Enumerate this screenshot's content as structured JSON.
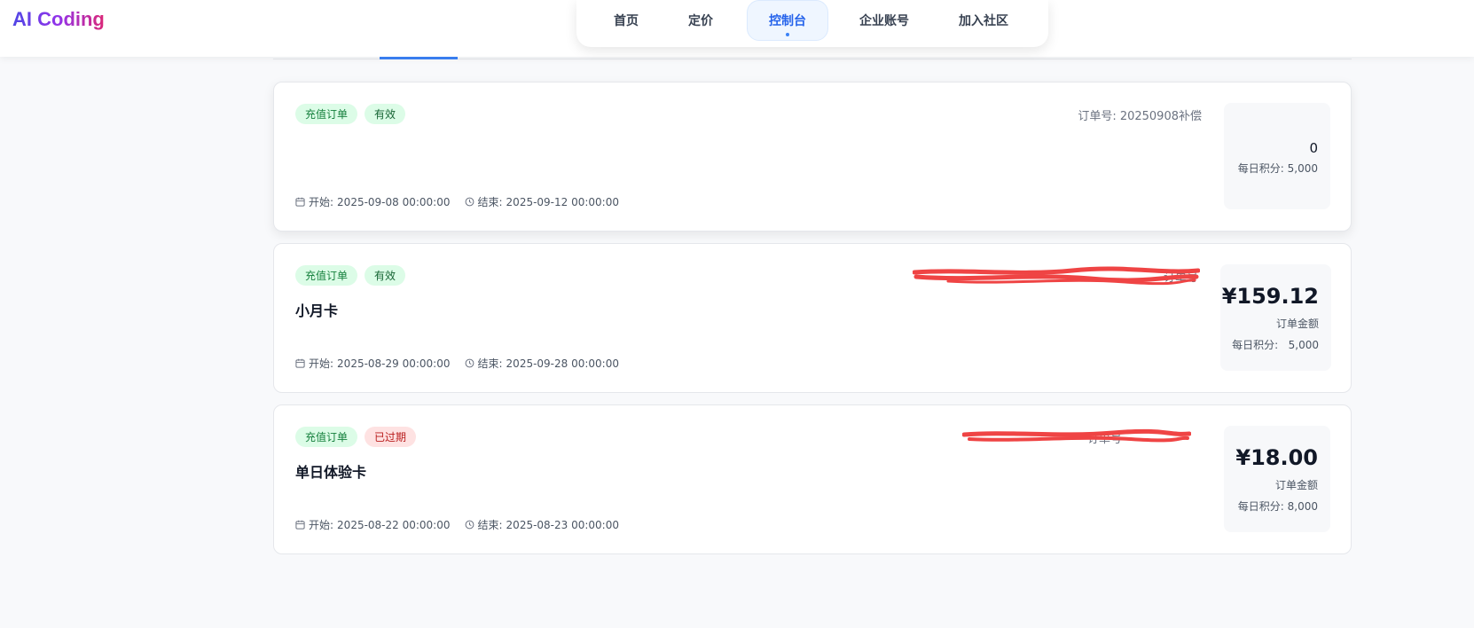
{
  "app": {
    "logo": "AI Coding"
  },
  "nav": {
    "items": [
      {
        "label": "首页"
      },
      {
        "label": "定价"
      },
      {
        "label": "控制台"
      },
      {
        "label": "企业账号"
      },
      {
        "label": "加入社区"
      }
    ],
    "active": "控制台"
  },
  "orders": [
    {
      "type_tag": "充值订单",
      "status_tag": "有效",
      "name": "",
      "order_no_label": "订单号: ",
      "order_no": "20250908补偿",
      "amount": "0",
      "amount_label": "",
      "points_label": "每日积分:",
      "points": "5,000",
      "start_label": "开始: ",
      "start": "2025-09-08 00:00:00",
      "end_label": "结束: ",
      "end": "2025-09-12 00:00:00"
    },
    {
      "type_tag": "充值订单",
      "status_tag": "有效",
      "name": "小月卡",
      "order_no_label": "订单号",
      "order_no": "",
      "amount": "¥159.12",
      "amount_label": "订单金额",
      "points_label": "每日积分:",
      "points": "5,000",
      "start_label": "开始: ",
      "start": "2025-08-29 00:00:00",
      "end_label": "结束: ",
      "end": "2025-09-28 00:00:00"
    },
    {
      "type_tag": "充值订单",
      "status_tag": "已过期",
      "name": "单日体验卡",
      "order_no_label": "订单号",
      "order_no": "",
      "amount": "¥18.00",
      "amount_label": "订单金额",
      "points_label": "每日积分:",
      "points": "8,000",
      "start_label": "开始: ",
      "start": "2025-08-22 00:00:00",
      "end_label": "结束: ",
      "end": "2025-08-23 00:00:00"
    }
  ],
  "colors": {
    "accent": "#3b82f6",
    "tag_green_bg": "#dcfce7",
    "tag_red_bg": "#fee2e2",
    "redaction": "#ef4444"
  }
}
